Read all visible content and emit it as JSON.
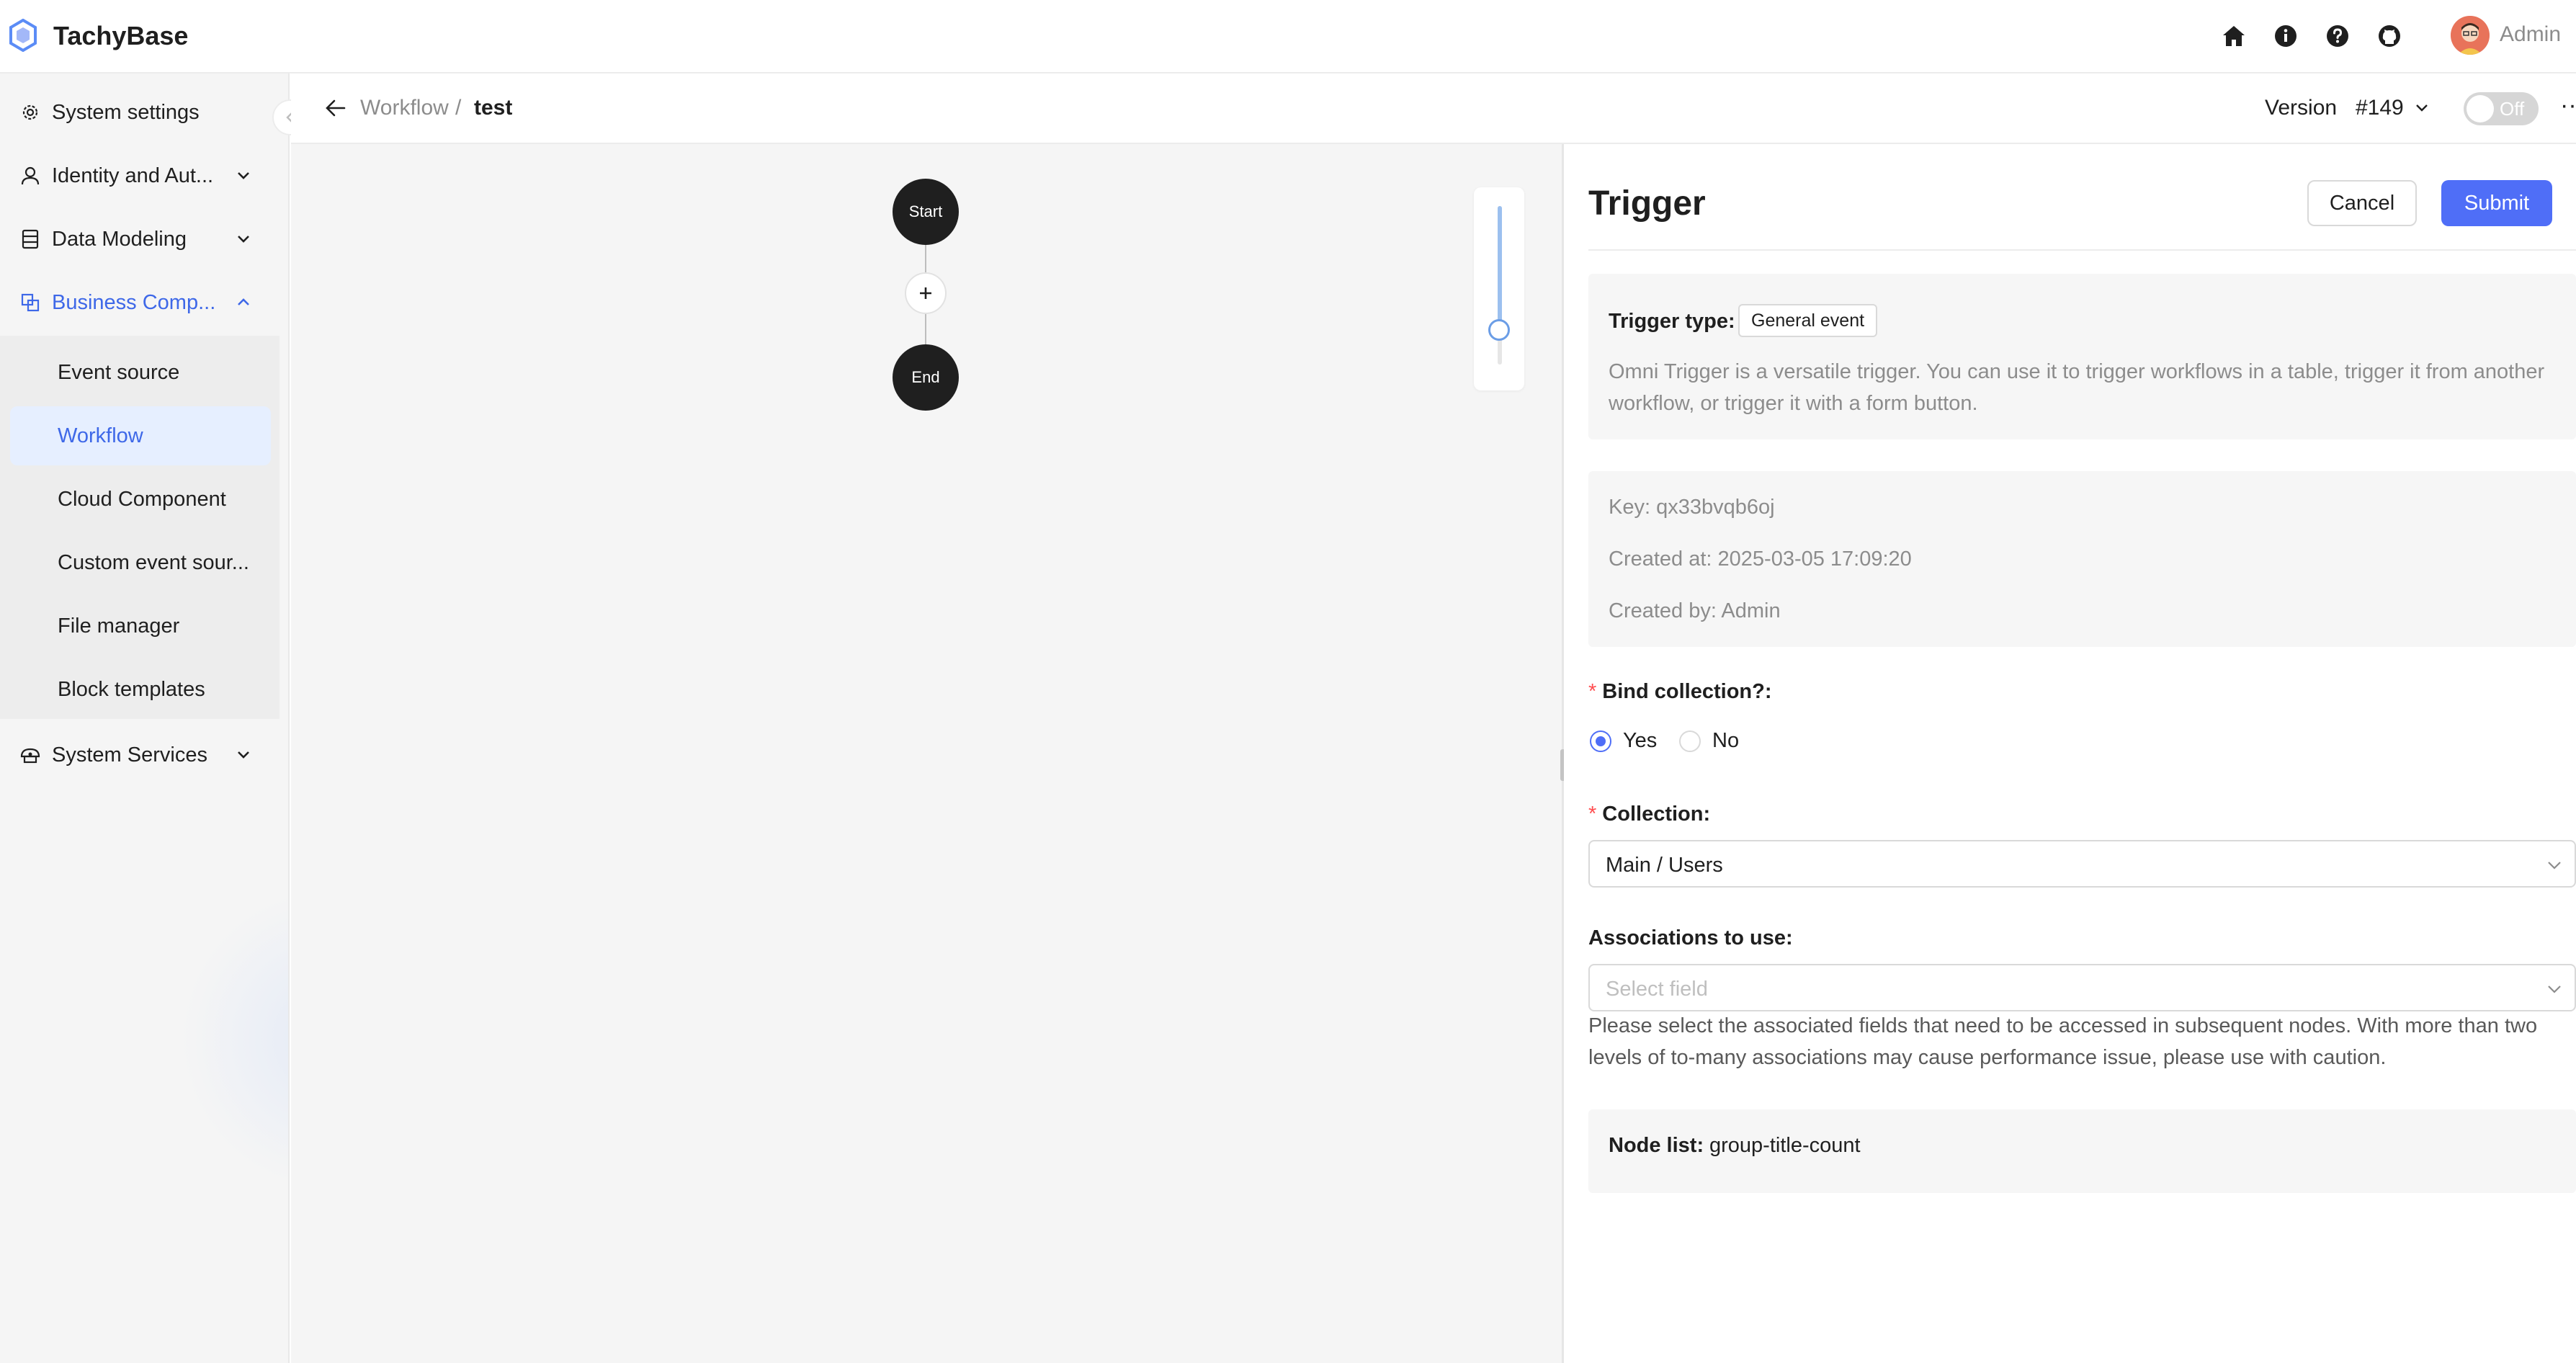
{
  "app": {
    "brand": "TachyBase",
    "user_name": "Admin"
  },
  "header": {
    "icons": [
      "home-icon",
      "info-icon",
      "help-icon",
      "github-icon"
    ]
  },
  "sidebar": {
    "items": [
      {
        "label": "System settings",
        "icon": "gear-icon"
      },
      {
        "label": "Identity and Aut...",
        "icon": "user-icon"
      },
      {
        "label": "Data Modeling",
        "icon": "database-icon"
      },
      {
        "label": "Business Comp...",
        "icon": "business-icon",
        "expanded": true
      },
      {
        "label": "System Services",
        "icon": "cloud-services-icon"
      }
    ],
    "subitems": [
      {
        "label": "Event source"
      },
      {
        "label": "Workflow",
        "selected": true
      },
      {
        "label": "Cloud Component"
      },
      {
        "label": "Custom event sour..."
      },
      {
        "label": "File manager"
      },
      {
        "label": "Block templates"
      }
    ]
  },
  "breadcrumb": {
    "parent": "Workflow",
    "separator": "/",
    "current": "test"
  },
  "version": {
    "label": "Version",
    "value": "#149"
  },
  "toggle": {
    "label": "Off",
    "on": false
  },
  "more": "···",
  "canvas": {
    "start_label": "Start",
    "end_label": "End",
    "add_symbol": "+",
    "zoom_level": 0.22
  },
  "panel": {
    "title": "Trigger",
    "cancel_label": "Cancel",
    "submit_label": "Submit",
    "trigger_type_label": "Trigger type:",
    "trigger_type_value": "General event",
    "trigger_description": "Omni Trigger is a versatile trigger. You can use it to trigger workflows in a table, trigger it from another workflow, or trigger it with a form button.",
    "meta": {
      "key": "Key: qx33bvqb6oj",
      "created_at": "Created at: 2025-03-05 17:09:20",
      "created_by": "Created by: Admin"
    },
    "bind_collection": {
      "label": "Bind collection?",
      "colon": ":",
      "required": "*",
      "options": [
        "Yes",
        "No"
      ],
      "selected": "Yes"
    },
    "collection": {
      "label": "Collection",
      "colon": ":",
      "required": "*",
      "value": "Main / Users"
    },
    "associations": {
      "label": "Associations to use",
      "colon": ":",
      "placeholder": "Select field",
      "help": "Please select the associated fields that need to be accessed in subsequent nodes. With more than two levels of to-many associations may cause performance issue, please use with caution."
    },
    "node_list": {
      "label": "Node list:",
      "value": "group-title-count"
    }
  },
  "colors": {
    "accent": "#4f6ef7",
    "active_menu_text": "#3e68e8",
    "selected_menu_bg": "#e6efff",
    "node_fill": "#1f1f1f",
    "required": "#ff4d4f"
  }
}
